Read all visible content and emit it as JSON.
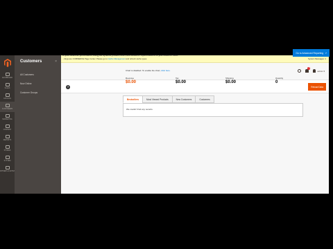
{
  "notice": {
    "text_before": "...ttings are COMMERCE Page Center. Please go to",
    "link": "Cache Management",
    "text_after": "and refresh cache types.",
    "system_messages": "System Messages: 1"
  },
  "rail": [
    {
      "label": "DASHBOARD",
      "active": false
    },
    {
      "label": "SALES",
      "active": false
    },
    {
      "label": "CATALOG",
      "active": false
    },
    {
      "label": "CUSTOMERS",
      "active": true
    },
    {
      "label": "MARKETING",
      "active": false
    },
    {
      "label": "CONTENT",
      "active": false
    },
    {
      "label": "REPORTS",
      "active": false
    },
    {
      "label": "STORES",
      "active": false
    },
    {
      "label": "SYSTEM",
      "active": false
    },
    {
      "label": "FIND PARTNERS & EXTENSIONS",
      "active": false
    }
  ],
  "flyout": {
    "title": "Customers",
    "close": "×",
    "items": [
      "All Customers",
      "Now Online",
      "Customer Groups"
    ]
  },
  "header": {
    "notification_count": "1",
    "user": "admin ▾"
  },
  "titlebar": {
    "reload_label": "Reload Data"
  },
  "reporting": {
    "text": "of your business' performance, using our dynamic product, order, and customer reports tailored to your customer data.",
    "button": "Go to Advanced Reporting",
    "button_icon": "↗"
  },
  "chart_notice": {
    "text": "Chart is disabled. To enable the chart,",
    "link": "click here."
  },
  "totals": [
    {
      "label": "Revenue",
      "value": "$0.00",
      "color": "#eb5202"
    },
    {
      "label": "Tax",
      "value": "$0.00",
      "color": "#303030"
    },
    {
      "label": "Shipping",
      "value": "$0.00",
      "color": "#303030"
    },
    {
      "label": "Quantity",
      "value": "0",
      "color": "#303030"
    }
  ],
  "tabs": [
    "Bestsellers",
    "Most Viewed Products",
    "New Customers",
    "Customers"
  ],
  "tab_panel": {
    "empty_text": "We couldn't find any records."
  },
  "colors": {
    "accent": "#eb5202",
    "link": "#007bdb",
    "rail_bg": "#373330",
    "flyout_bg": "#4a4542"
  }
}
